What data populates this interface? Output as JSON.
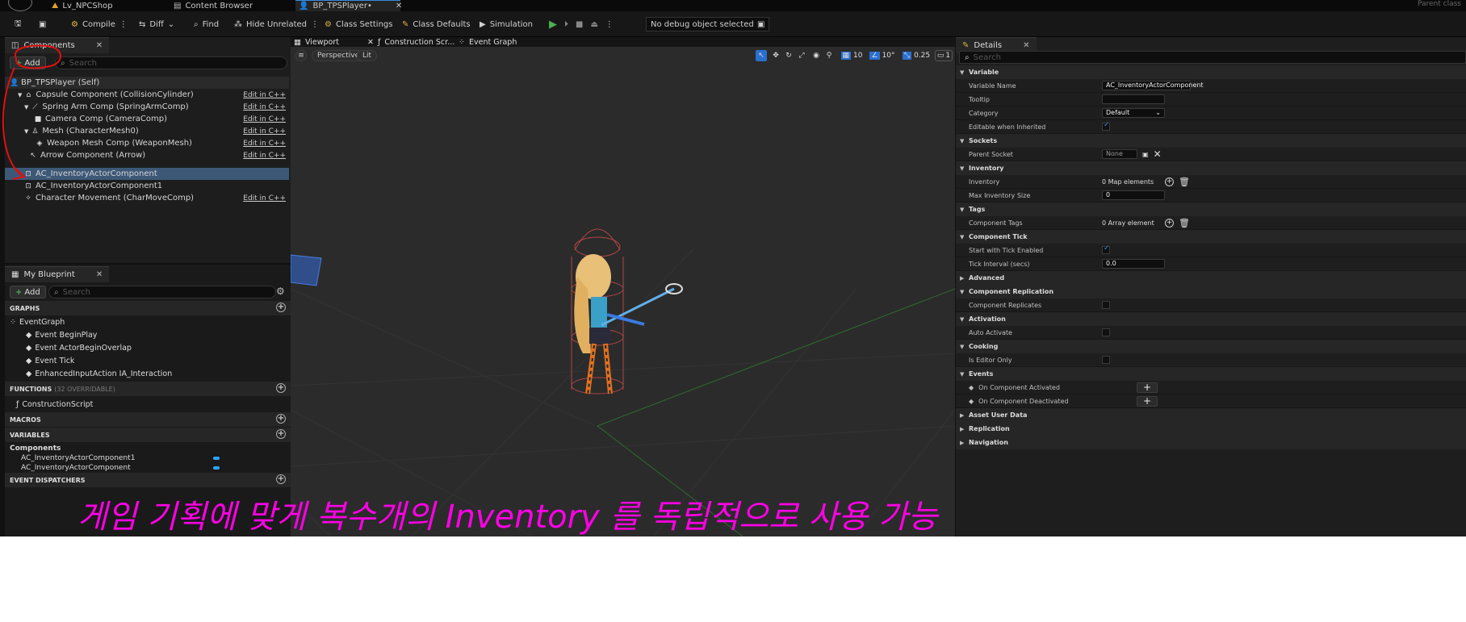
{
  "top_tabs": [
    {
      "label": "Lv_NPCShop",
      "active": false
    },
    {
      "label": "Content Browser",
      "active": false
    },
    {
      "label": "BP_TPSPlayer•",
      "active": true
    }
  ],
  "parent_class_label": "Parent class",
  "toolbar": {
    "compile": "Compile",
    "diff": "Diff",
    "find": "Find",
    "hide_unrelated": "Hide Unrelated",
    "class_settings": "Class Settings",
    "class_defaults": "Class Defaults",
    "simulation": "Simulation",
    "debug_select": "No debug object selected"
  },
  "components_panel": {
    "tab": "Components",
    "add": "Add",
    "search_placeholder": "Search",
    "items": [
      {
        "label": "BP_TPSPlayer (Self)",
        "edit": ""
      },
      {
        "label": "Capsule Component (CollisionCylinder)",
        "edit": "Edit in C++"
      },
      {
        "label": "Spring Arm Comp (SpringArmComp)",
        "edit": "Edit in C++"
      },
      {
        "label": "Camera Comp (CameraComp)",
        "edit": "Edit in C++"
      },
      {
        "label": "Mesh (CharacterMesh0)",
        "edit": "Edit in C++"
      },
      {
        "label": "Weapon Mesh Comp (WeaponMesh)",
        "edit": "Edit in C++"
      },
      {
        "label": "Arrow Component (Arrow)",
        "edit": "Edit in C++"
      },
      {
        "label": "AC_InventoryActorComponent",
        "edit": ""
      },
      {
        "label": "AC_InventoryActorComponent1",
        "edit": ""
      },
      {
        "label": "Character Movement (CharMoveComp)",
        "edit": "Edit in C++"
      }
    ]
  },
  "my_blueprint": {
    "tab": "My Blueprint",
    "add": "Add",
    "search_placeholder": "Search",
    "graphs_header": "GRAPHS",
    "event_graph": "EventGraph",
    "events": [
      "Event BeginPlay",
      "Event ActorBeginOverlap",
      "Event Tick",
      "EnhancedInputAction IA_Interaction"
    ],
    "functions_header": "FUNCTIONS",
    "functions_note": "(32 OVERRIDABLE)",
    "construction_script": "ConstructionScript",
    "macros_header": "MACROS",
    "variables_header": "VARIABLES",
    "components_group": "Components",
    "variables": [
      "AC_InventoryActorComponent1",
      "AC_InventoryActorComponent"
    ],
    "dispatchers_header": "EVENT DISPATCHERS"
  },
  "viewport": {
    "tabs": [
      "Viewport",
      "Construction Scr...",
      "Event Graph"
    ],
    "perspective": "Perspective",
    "lit": "Lit",
    "grid_snap": "10",
    "rot_snap": "10°",
    "scale_snap": "0.25",
    "camera_speed": "1"
  },
  "details": {
    "tab": "Details",
    "search_placeholder": "Search",
    "rows": [
      {
        "type": "section",
        "label": "Variable"
      },
      {
        "type": "row",
        "label": "Variable Name",
        "kind": "input",
        "value": "AC_InventoryActorComponent",
        "w": 110
      },
      {
        "type": "row",
        "label": "Tooltip",
        "kind": "input",
        "value": "",
        "w": 78
      },
      {
        "type": "row",
        "label": "Category",
        "kind": "dropdown",
        "value": "Default"
      },
      {
        "type": "row",
        "label": "Editable when Inherited",
        "kind": "check",
        "checked": true
      },
      {
        "type": "section",
        "label": "Sockets"
      },
      {
        "type": "row",
        "label": "Parent Socket",
        "kind": "socket",
        "value": "None"
      },
      {
        "type": "section",
        "label": "Inventory"
      },
      {
        "type": "row",
        "label": "Inventory",
        "kind": "map",
        "value": "0 Map elements"
      },
      {
        "type": "row",
        "label": "Max Inventory Size",
        "kind": "input",
        "value": "0",
        "w": 78
      },
      {
        "type": "section",
        "label": "Tags"
      },
      {
        "type": "row",
        "label": "Component Tags",
        "kind": "map",
        "value": "0 Array element"
      },
      {
        "type": "section",
        "label": "Component Tick"
      },
      {
        "type": "row",
        "label": "Start with Tick Enabled",
        "kind": "check",
        "checked": true
      },
      {
        "type": "row",
        "label": "Tick Interval (secs)",
        "kind": "input",
        "value": "0.0",
        "w": 78
      },
      {
        "type": "section",
        "label": "Advanced",
        "collapsed": true
      },
      {
        "type": "section",
        "label": "Component Replication"
      },
      {
        "type": "row",
        "label": "Component Replicates",
        "kind": "check",
        "checked": false
      },
      {
        "type": "section",
        "label": "Activation"
      },
      {
        "type": "row",
        "label": "Auto Activate",
        "kind": "check",
        "checked": false
      },
      {
        "type": "section",
        "label": "Cooking"
      },
      {
        "type": "row",
        "label": "Is Editor Only",
        "kind": "check",
        "checked": false
      },
      {
        "type": "section",
        "label": "Events"
      },
      {
        "type": "row",
        "label": "On Component Activated",
        "kind": "event"
      },
      {
        "type": "row",
        "label": "On Component Deactivated",
        "kind": "event"
      },
      {
        "type": "section",
        "label": "Asset User Data",
        "collapsed": true
      },
      {
        "type": "section",
        "label": "Replication",
        "collapsed": true
      },
      {
        "type": "section",
        "label": "Navigation",
        "collapsed": true
      }
    ]
  },
  "caption": "게임 기획에 맞게 복수개의 Inventory 를 독립적으로 사용 가능",
  "colors": {
    "caption": "#ff00e6",
    "annotation": "#e01010",
    "selection": "#3d5877",
    "accent": "#3a8be0"
  }
}
